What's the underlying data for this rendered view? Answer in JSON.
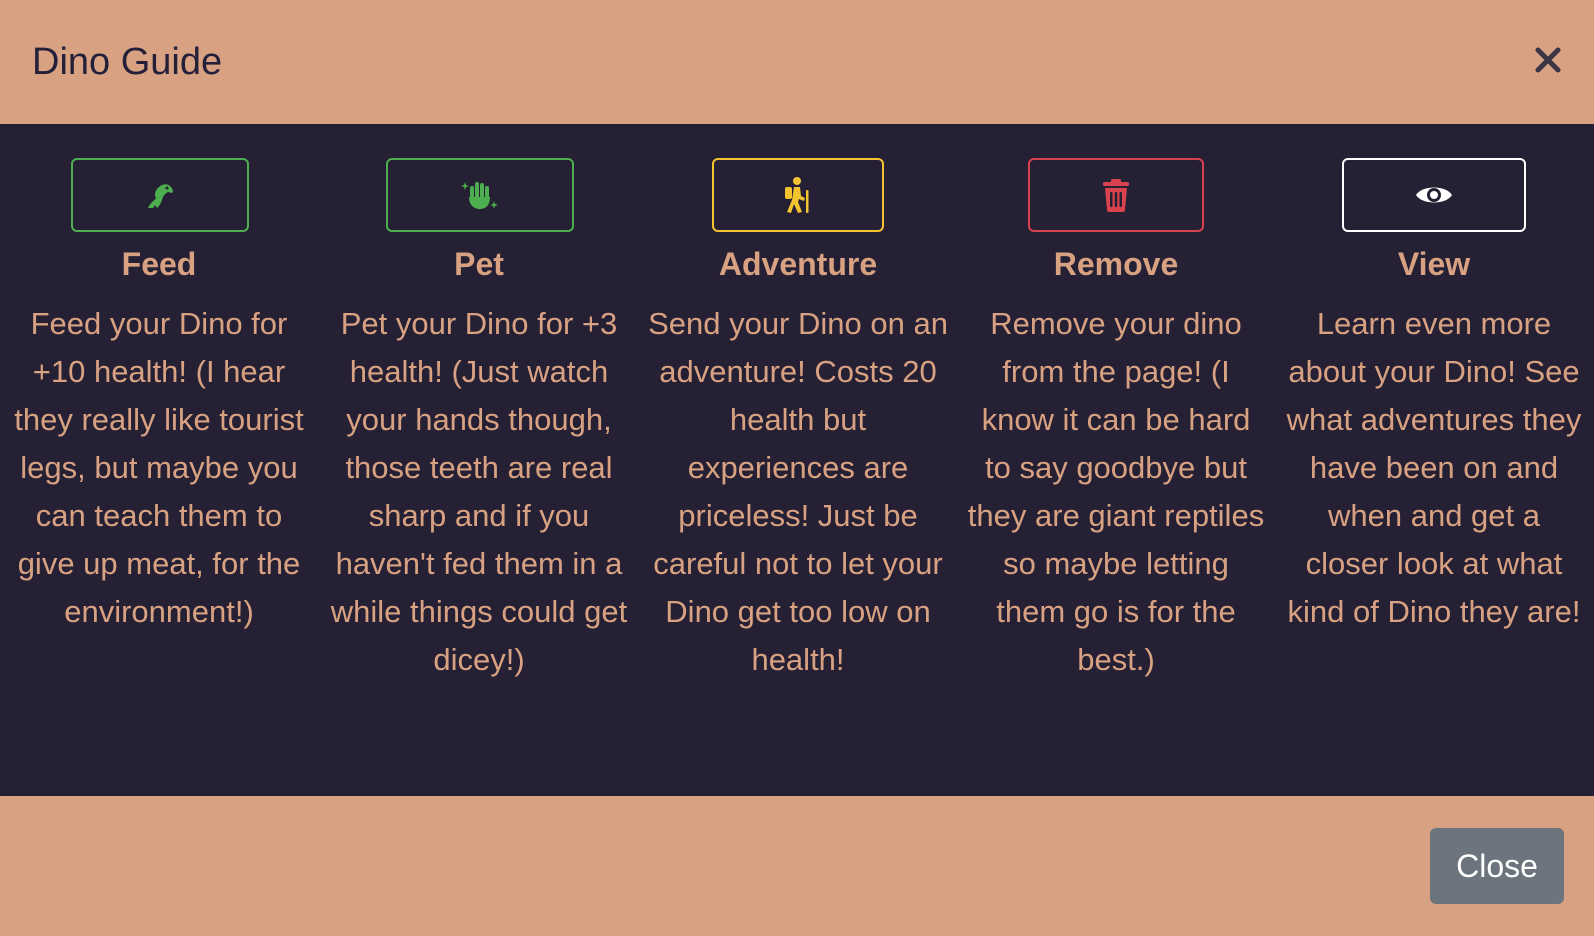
{
  "modal": {
    "title": "Dino Guide",
    "close_icon": "close-icon"
  },
  "actions": [
    {
      "key": "feed",
      "label": "Feed",
      "icon": "dino-icon",
      "color": "#4cae4f",
      "description": "Feed your Dino for +10 health! (I hear they really like tourist legs, but maybe you can teach them to give up meat, for the environment!)"
    },
    {
      "key": "pet",
      "label": "Pet",
      "icon": "sparkle-hand-icon",
      "color": "#4cae4f",
      "description": "Pet your Dino for +3 health! (Just watch your hands though, those teeth are real sharp and if you haven't fed them in a while things could get dicey!)"
    },
    {
      "key": "adventure",
      "label": "Adventure",
      "icon": "hiking-icon",
      "color": "#f4c430",
      "description": "Send your Dino on an adventure! Costs 20 health but experiences are priceless! Just be careful not to let your Dino get too low on health!"
    },
    {
      "key": "remove",
      "label": "Remove",
      "icon": "trash-icon",
      "color": "#d9434e",
      "description": "Remove your dino from the page! (I know it can be hard to say goodbye but they are giant reptiles so maybe letting them go is for the best.)"
    },
    {
      "key": "view",
      "label": "View",
      "icon": "eye-icon",
      "color": "#ffffff",
      "description": "Learn even more about your Dino! See what adventures they have been on and when and get a closer look at what kind of Dino they are!"
    }
  ],
  "footer": {
    "close_label": "Close"
  },
  "colors": {
    "header_bg": "#d8a282",
    "body_bg": "#262034",
    "text_accent": "#d8a282",
    "close_button_bg": "#6c757d"
  }
}
